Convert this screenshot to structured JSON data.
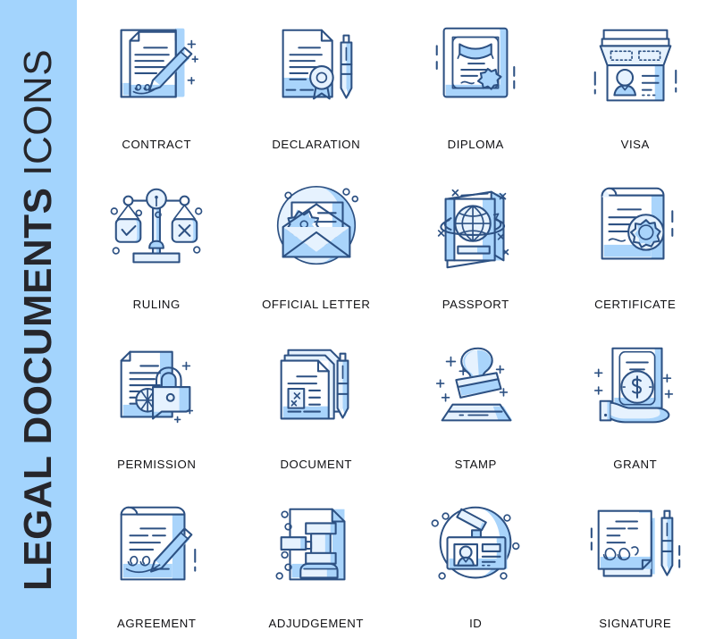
{
  "banner": {
    "title_bold": "LEGAL DOCUMENTS",
    "title_light": " ICONS",
    "full_title": "LEGAL DOCUMENTS ICONS",
    "background_color": "#a3d4fd",
    "text_color": "#26262b"
  },
  "palette": {
    "stroke_navy": "#2d5183",
    "fill_mid_blue": "#a9d4fb",
    "fill_pale_blue": "#e6f2fe",
    "paper_white": "#ffffff",
    "label_text": "#111114",
    "page_background": "#ffffff"
  },
  "chart_data": {
    "type": "table",
    "title": "LEGAL DOCUMENTS ICONS",
    "columns": 4,
    "rows": 4,
    "cells": [
      "CONTRACT",
      "DECLARATION",
      "DIPLOMA",
      "VISA",
      "RULING",
      "OFFICIAL LETTER",
      "PASSPORT",
      "CERTIFICATE",
      "PERMISSION",
      "DOCUMENT",
      "STAMP",
      "GRANT",
      "AGREEMENT",
      "ADJUDGEMENT",
      "ID",
      "SIGNATURE"
    ]
  },
  "grid": {
    "items": [
      {
        "label": "CONTRACT",
        "icon": "contract-icon"
      },
      {
        "label": "DECLARATION",
        "icon": "declaration-icon"
      },
      {
        "label": "DIPLOMA",
        "icon": "diploma-icon"
      },
      {
        "label": "VISA",
        "icon": "visa-icon"
      },
      {
        "label": "RULING",
        "icon": "ruling-scales-icon"
      },
      {
        "label": "OFFICIAL LETTER",
        "icon": "official-letter-icon"
      },
      {
        "label": "PASSPORT",
        "icon": "passport-icon"
      },
      {
        "label": "CERTIFICATE",
        "icon": "certificate-icon"
      },
      {
        "label": "PERMISSION",
        "icon": "permission-lock-icon"
      },
      {
        "label": "DOCUMENT",
        "icon": "document-icon"
      },
      {
        "label": "STAMP",
        "icon": "stamp-icon"
      },
      {
        "label": "GRANT",
        "icon": "grant-hand-money-icon"
      },
      {
        "label": "AGREEMENT",
        "icon": "agreement-icon"
      },
      {
        "label": "ADJUDGEMENT",
        "icon": "adjudgement-gavel-icon"
      },
      {
        "label": "ID",
        "icon": "id-badge-icon"
      },
      {
        "label": "SIGNATURE",
        "icon": "signature-icon"
      }
    ]
  }
}
